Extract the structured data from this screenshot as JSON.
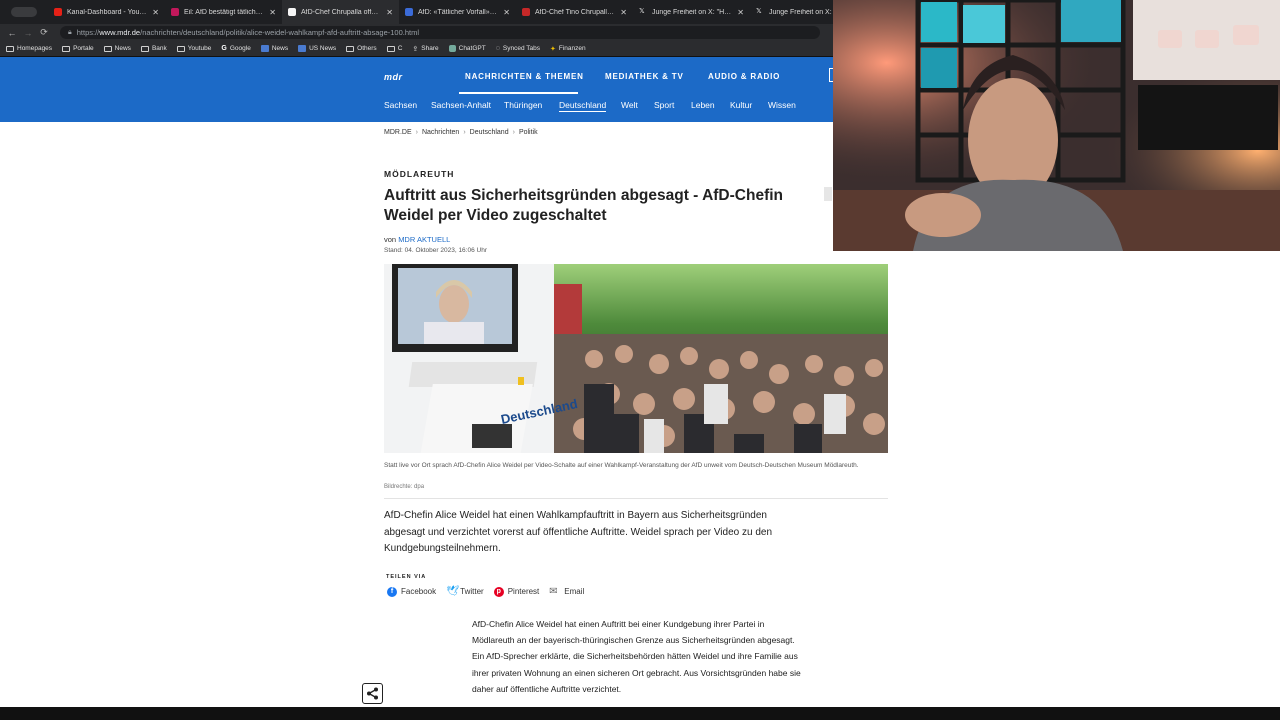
{
  "browser": {
    "tabs": [
      {
        "title": "Kanal-Dashboard - YouTube",
        "favicon_color": "#e62117"
      },
      {
        "title": "Eil: AfD bestätigt tätlichen A",
        "favicon_color": "#c2185b"
      },
      {
        "title": "AfD-Chef Chrupalla offenbar",
        "favicon_color": "#f5f5f5"
      },
      {
        "title": "AfD: «Tätlicher Vorfall» gegen",
        "favicon_color": "#3b6bd8"
      },
      {
        "title": "AfD-Chef Tino Chrupalla ins",
        "favicon_color": "#c62828"
      },
      {
        "title": "Junge Freiheit on X: \"Hier wi",
        "favicon_color": "#eeeeee"
      },
      {
        "title": "Junge Freiheit on X: \"A",
        "favicon_color": "#eeeeee"
      }
    ],
    "url_prefix": "https://",
    "url_host": "www.mdr.de",
    "url_path": "/nachrichten/deutschland/politik/alice-weidel-wahlkampf-afd-auftritt-absage-100.html",
    "bookmarks": [
      "Homepages",
      "Portale",
      "News",
      "Bank",
      "Youtube",
      "Google",
      "News",
      "US News",
      "Others",
      "C",
      "Share",
      "ChatGPT",
      "Synced Tabs",
      "Finanzen"
    ]
  },
  "site": {
    "logo": "mdr",
    "top_nav": [
      "NACHRICHTEN & THEMEN",
      "MEDIATHEK & TV",
      "AUDIO & RADIO"
    ],
    "sub_nav": [
      "Sachsen",
      "Sachsen-Anhalt",
      "Thüringen",
      "Deutschland",
      "Welt",
      "Sport",
      "Leben",
      "Kultur",
      "Wissen"
    ],
    "sub_nav_active": "Deutschland"
  },
  "article": {
    "breadcrumb": [
      "MDR.DE",
      "Nachrichten",
      "Deutschland",
      "Politik"
    ],
    "kicker": "MÖDLAREUTH",
    "headline": "Auftritt aus Sicherheitsgründen abgesagt - AfD-Chefin Weidel per Video zugeschaltet",
    "byline_prefix": "von",
    "byline_source": "MDR AKTUELL",
    "date": "Stand: 04. Oktober 2023, 16:06 Uhr",
    "image_banner_text": "Deutschland",
    "caption": "Statt live vor Ort sprach AfD-Chefin Alice Weidel per Video-Schalte auf einer Wahlkampf-Veranstaltung der AfD unweit vom Deutsch-Deutschen Museum Mödlareuth.",
    "credit": "Bildrechte: dpa",
    "lead": "AfD-Chefin Alice Weidel hat einen Wahlkampfauftritt in Bayern aus Sicherheitsgründen abgesagt und verzichtet vorerst auf öffentliche Auftritte. Weidel sprach per Video zu den Kundgebungsteilnehmern.",
    "share_label": "TEILEN VIA",
    "share": [
      {
        "label": "Facebook",
        "color": "#1877f2",
        "glyph": "f"
      },
      {
        "label": "Twitter",
        "color": "#1da1f2",
        "glyph": "t"
      },
      {
        "label": "Pinterest",
        "color": "#e60023",
        "glyph": "p"
      },
      {
        "label": "Email",
        "color": "#666666",
        "glyph": "✉"
      }
    ],
    "body": "AfD-Chefin Alice Weidel hat einen Auftritt bei einer Kundgebung ihrer Partei in Mödlareuth an der bayerisch-thüringischen Grenze aus Sicherheitsgründen abgesagt. Ein AfD-Sprecher erklärte, die Sicherheitsbehörden hätten Weidel und ihre Familie aus ihrer privaten Wohnung an einen sicheren Ort gebracht. Aus Vorsichtsgründen habe sie daher auf öffentliche Auftritte verzichtet."
  },
  "colors": {
    "brand": "#1c6ac7"
  }
}
